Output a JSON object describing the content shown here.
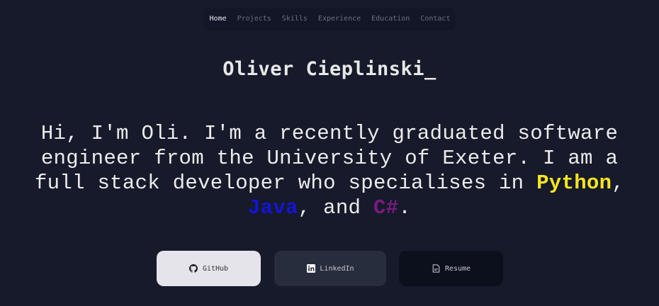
{
  "nav": {
    "items": [
      "Home",
      "Projects",
      "Skills",
      "Experience",
      "Education",
      "Contact"
    ],
    "active": "Home"
  },
  "hero": {
    "name": "Oliver Cieplinski",
    "cursor": "_",
    "intro": {
      "line1": "Hi, I'm Oli. I'm a recently graduated software",
      "line2": "engineer from the University of Exeter. I am a",
      "line3_prefix": "full stack developer who specialises in ",
      "python": "Python",
      "comma1": ",",
      "java": "Java",
      "mid": ", and ",
      "csharp": "C#",
      "end": "."
    }
  },
  "buttons": {
    "github": "GitHub",
    "linkedin": "LinkedIn",
    "resume": "Resume"
  },
  "colors": {
    "background": "#161a2b",
    "python": "#f7e51f",
    "java": "#1414d6",
    "csharp": "#7a1a80"
  },
  "icons": {
    "github": "github-icon",
    "linkedin": "linkedin-icon",
    "resume": "document-icon"
  }
}
